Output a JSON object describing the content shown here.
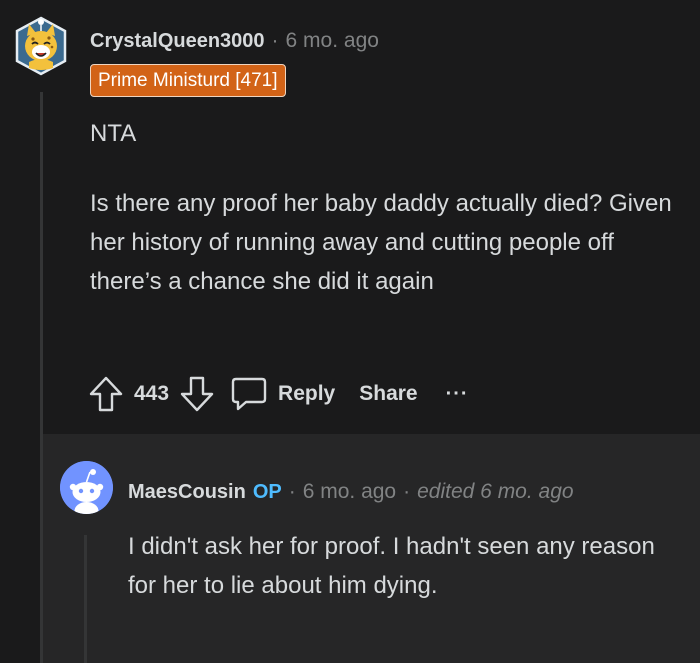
{
  "comment": {
    "username": "CrystalQueen3000",
    "separator": "·",
    "time": "6 mo. ago",
    "flair": "Prime Ministurd [471]",
    "paragraphs": [
      "NTA",
      "Is there any proof her baby daddy actually died? Given her history of running away and cutting people off there’s a chance she did it again"
    ],
    "score": "443",
    "reply_label": "Reply",
    "share_label": "Share",
    "more_label": "···",
    "avatar_icon": "snoo-cheetah-avatar-icon"
  },
  "reply": {
    "username": "MaesCousin",
    "op_label": "OP",
    "separator": "·",
    "time": "6 mo. ago",
    "edited": "edited 6 mo. ago",
    "body": "I didn't ask her for proof. I hadn't seen any reason for her to lie about him dying.",
    "avatar_icon": "default-snoo-avatar-icon"
  },
  "colors": {
    "background": "#1a1a1b",
    "reply_background": "#262627",
    "flair_background": "#d26317",
    "op_color": "#4fbcff",
    "meta_gray": "#818384",
    "avatar_blue": "#7193ff"
  }
}
